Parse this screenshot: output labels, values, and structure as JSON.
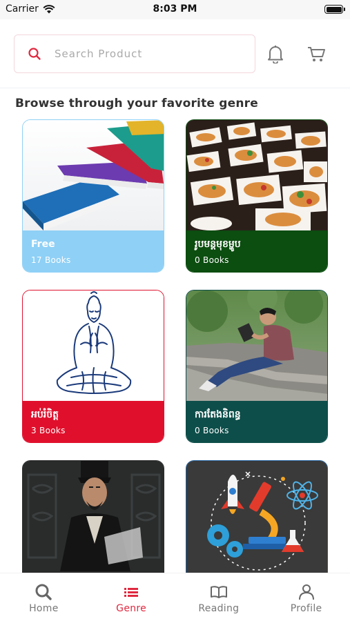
{
  "status_bar": {
    "carrier": "Carrier",
    "time": "8:03 PM"
  },
  "search": {
    "placeholder": "Search Product",
    "value": ""
  },
  "section_title": "Browse through your favorite genre",
  "genres": [
    {
      "title": "Free",
      "count": "17 Books",
      "color": "#8fd0f6",
      "border": "#8fd0f6"
    },
    {
      "title": "រូបមន្តមុខម្ហូប",
      "count": "0 Books",
      "color": "#0c4d10",
      "border": "#0c4d10"
    },
    {
      "title": "អប់រំចិត្ត",
      "count": "3 Books",
      "color": "#e0102c",
      "border": "#e0102c"
    },
    {
      "title": "ការតែងនិពន្ធ",
      "count": "0 Books",
      "color": "#0d4e4a",
      "border": "#0d4e4a"
    },
    {
      "title": "",
      "count": "",
      "color": "#2a2a2a",
      "border": "#2a2a2a"
    },
    {
      "title": "",
      "count": "",
      "color": "#3a3a3a",
      "border": "#1f5e9c"
    }
  ],
  "tabs": [
    {
      "label": "Home",
      "icon": "search-icon"
    },
    {
      "label": "Genre",
      "icon": "list-icon",
      "active": true
    },
    {
      "label": "Reading",
      "icon": "book-icon"
    },
    {
      "label": "Profile",
      "icon": "person-icon"
    }
  ],
  "colors": {
    "accent": "#e0283f",
    "search_border": "#f4d6dc"
  }
}
